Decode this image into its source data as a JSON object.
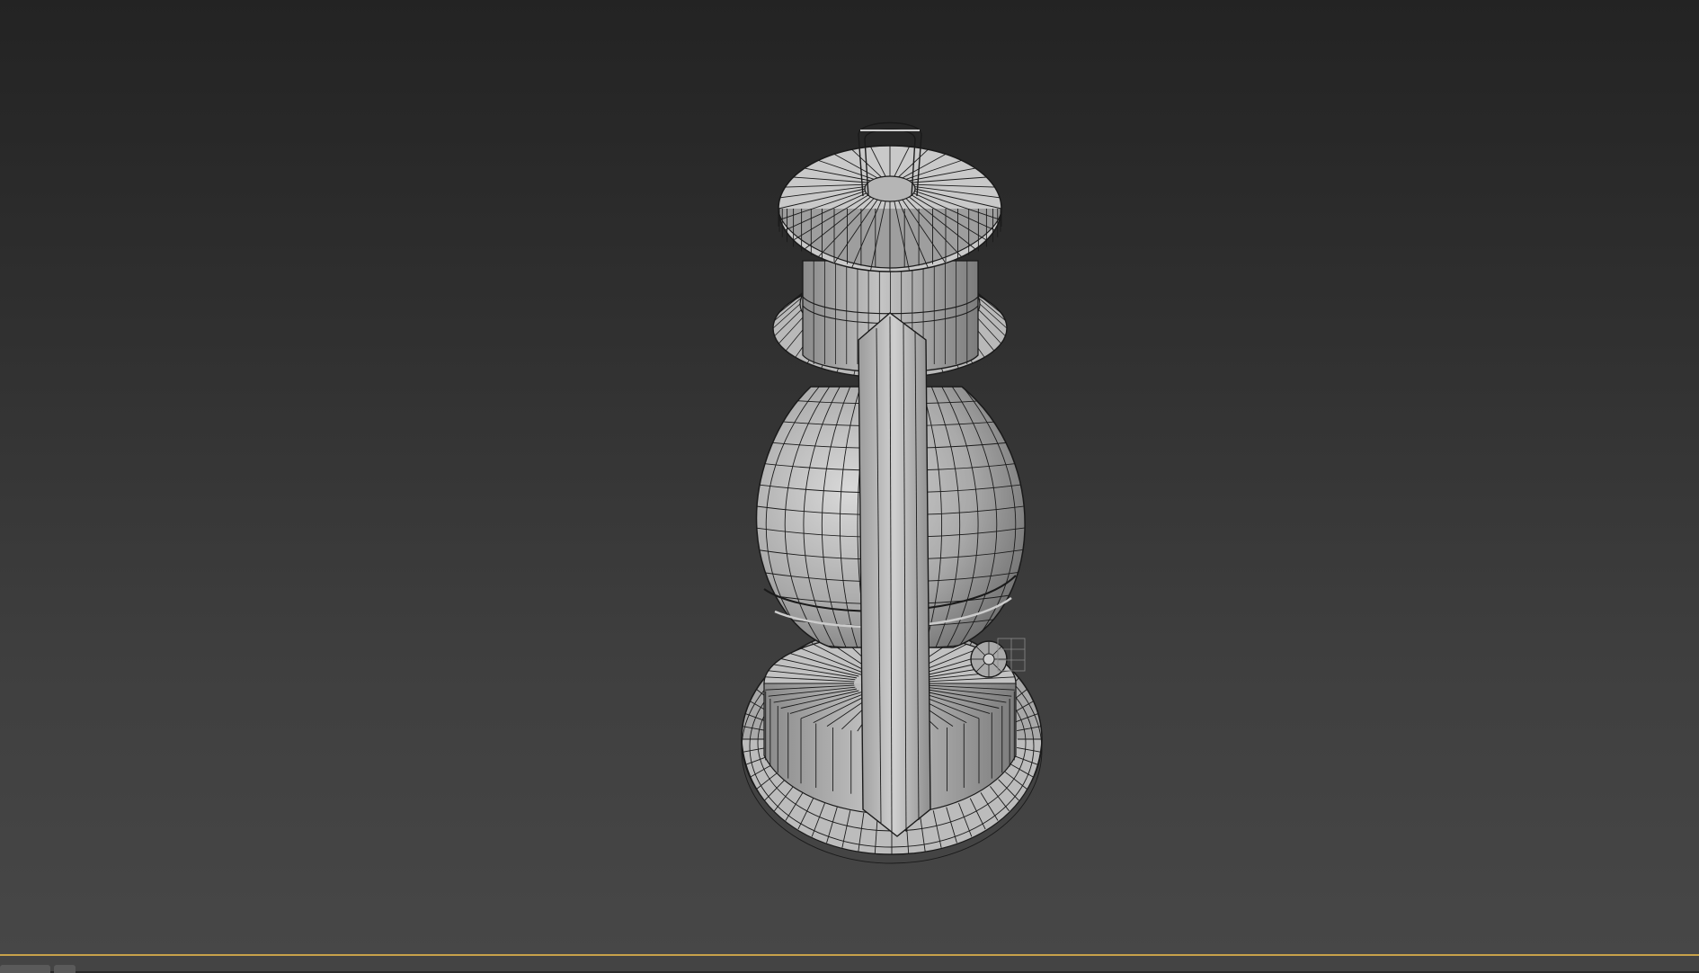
{
  "app": {
    "viewport_label": "",
    "accent_color": "#c8a24a",
    "background_top": "#232323",
    "background_bottom": "#474747"
  },
  "scene": {
    "object": "lantern-mesh",
    "display_mode": "shaded-with-edged-faces",
    "mesh_fill": "#bdbdbd",
    "mesh_edge": "#1a1a1a"
  },
  "icons": {
    "bottom_left_1": "panel-tab-icon",
    "bottom_left_2": "panel-tab-icon"
  }
}
